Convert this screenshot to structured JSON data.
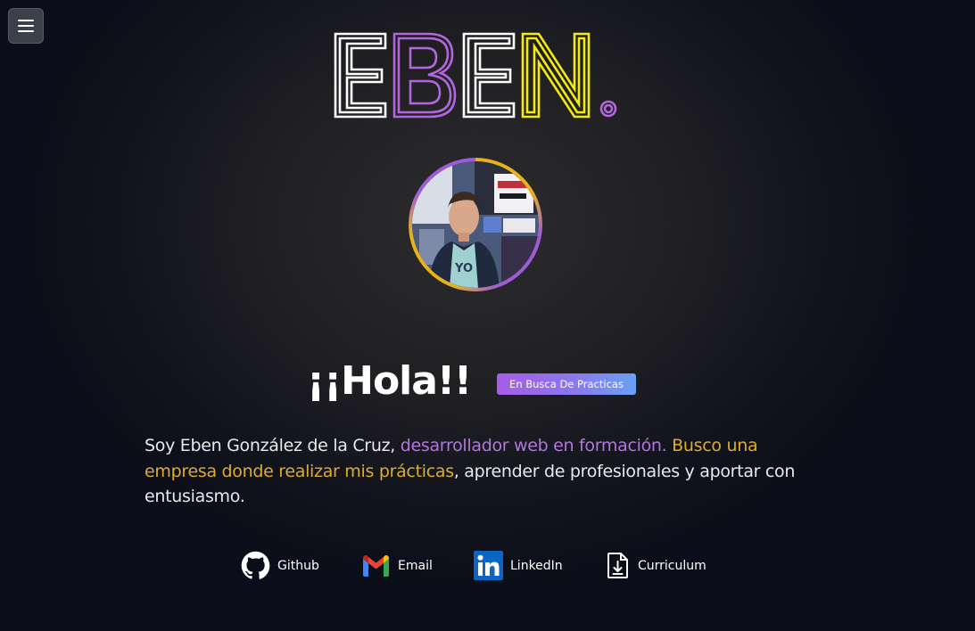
{
  "logo": {
    "letters": [
      "E",
      "B",
      "E",
      "N",
      "."
    ]
  },
  "colors": {
    "white": "#ffffff",
    "purple": "#b266dd",
    "yellow": "#f2ea10",
    "gold": "#e0ac2e",
    "badge_start": "#a75ce8",
    "badge_end": "#6aa1f2"
  },
  "greeting": "¡¡Hola!!",
  "badge": "En Busca De Practicas",
  "intro": {
    "part1": "Soy Eben González de la Cruz, ",
    "highlight_purple": "desarrollador web en formación.",
    "space": " ",
    "highlight_gold": "Busco una empresa donde realizar mis prácticas",
    "part2": ", aprender de profesionales y aportar con entusiasmo."
  },
  "links": [
    {
      "label": "Github",
      "icon": "github-icon"
    },
    {
      "label": "Email",
      "icon": "gmail-icon"
    },
    {
      "label": "LinkedIn",
      "icon": "linkedin-icon"
    },
    {
      "label": "Curriculum",
      "icon": "file-download-icon"
    }
  ],
  "menu": {
    "icon": "hamburger-icon"
  },
  "avatar": {
    "icon": "profile-photo"
  }
}
